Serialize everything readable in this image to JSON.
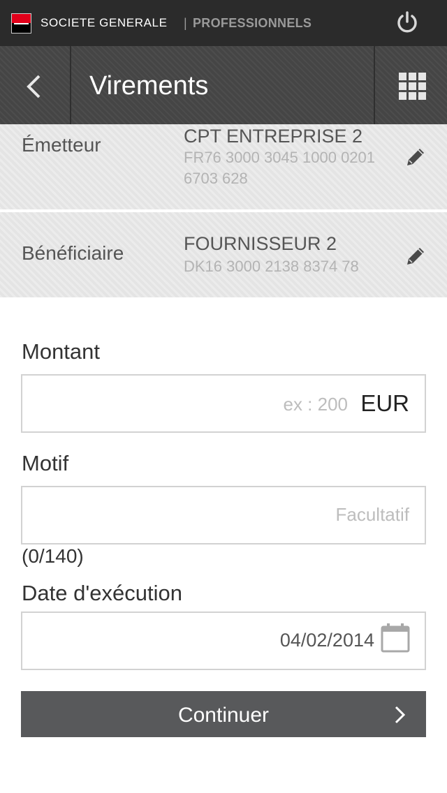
{
  "brand": {
    "name": "SOCIETE GENERALE",
    "separator": "|",
    "segment": "PROFESSIONNELS"
  },
  "header": {
    "title": "Virements"
  },
  "emetteur": {
    "label": "Émetteur",
    "account_name": "CPT ENTREPRISE 2",
    "iban_line1": "FR76 3000 3045 1000 0201",
    "iban_line2": "6703 628"
  },
  "beneficiaire": {
    "label": "Bénéficiaire",
    "account_name": "FOURNISSEUR 2",
    "iban": "DK16 3000 2138 8374 78"
  },
  "form": {
    "montant": {
      "label": "Montant",
      "placeholder": "ex : 200",
      "currency": "EUR"
    },
    "motif": {
      "label": "Motif",
      "placeholder": "Facultatif",
      "counter": "(0/140)"
    },
    "date": {
      "label": "Date d'exécution",
      "value": "04/02/2014"
    },
    "submit_label": "Continuer"
  },
  "icons": {
    "power": "power-icon",
    "back": "chevron-left-icon",
    "menu": "grid-menu-icon",
    "edit": "pencil-icon",
    "calendar": "calendar-icon",
    "next": "chevron-right-icon"
  },
  "colors": {
    "brand_red": "#e2001a",
    "topbar": "#2b2b2b",
    "navbar": "#4a4a4a",
    "button": "#58595b"
  }
}
